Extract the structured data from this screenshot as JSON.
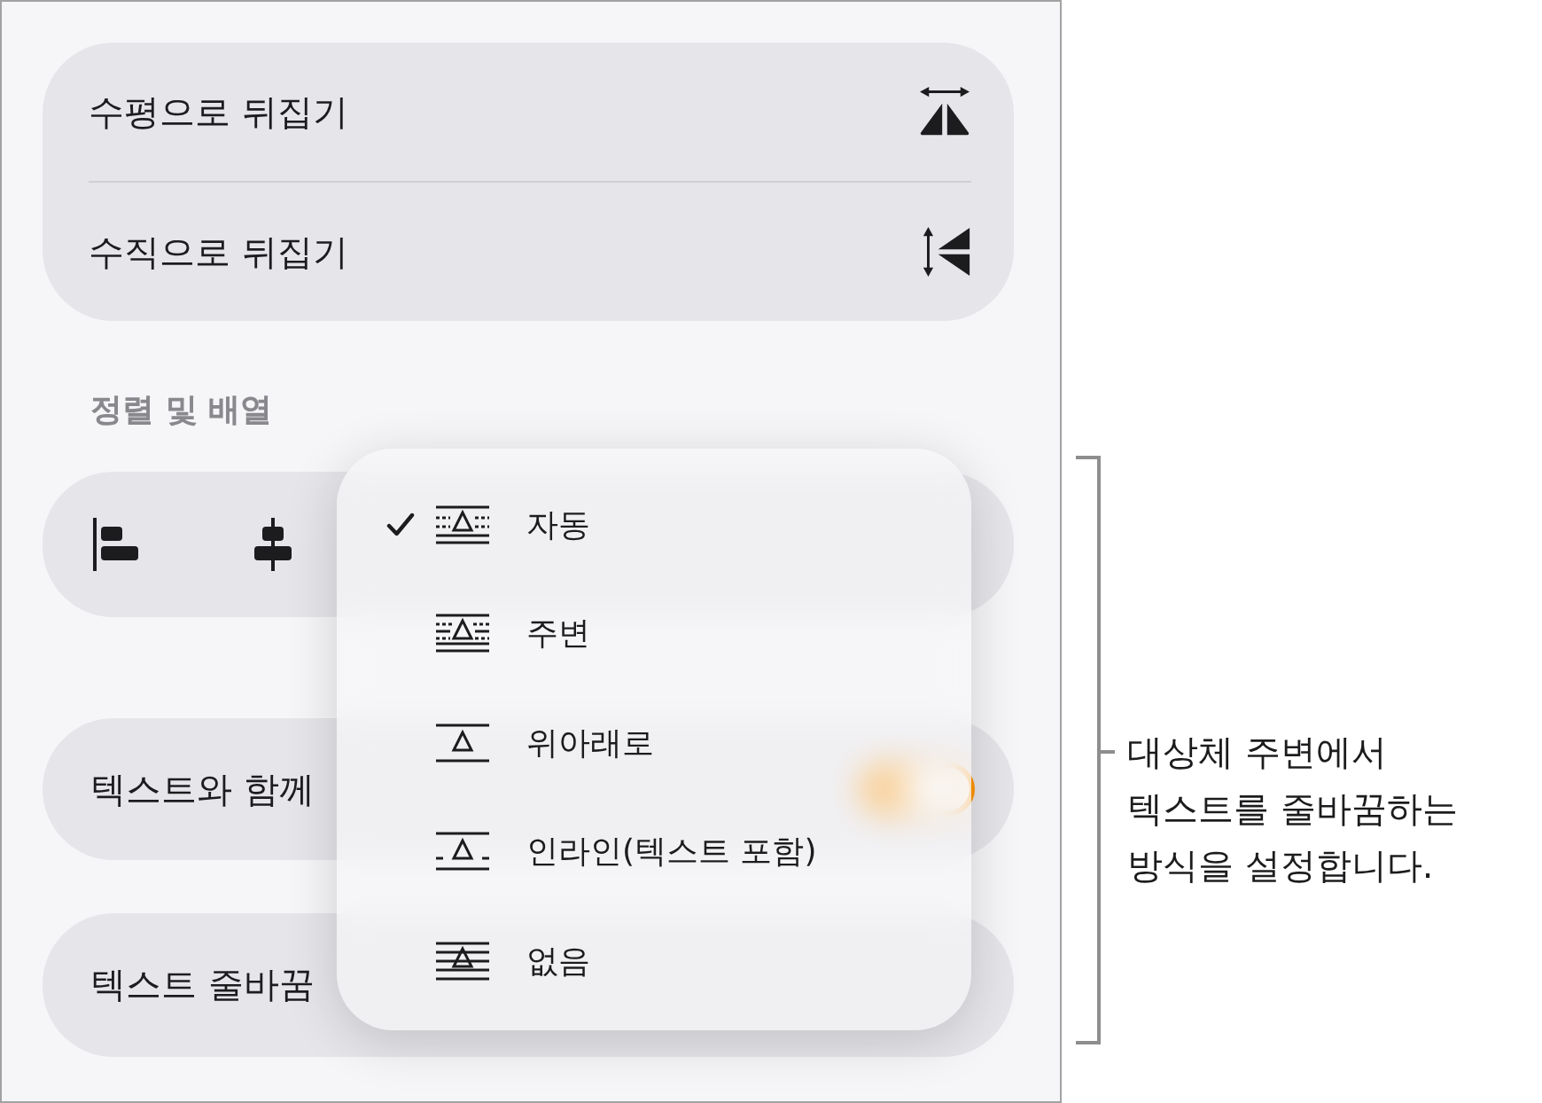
{
  "flip_options": [
    {
      "label": "수평으로 뒤집기",
      "kind": "horizontal"
    },
    {
      "label": "수직으로 뒤집기",
      "kind": "vertical"
    }
  ],
  "arrange": {
    "title": "정렬 및 배열",
    "align_buttons": [
      {
        "kind": "left"
      },
      {
        "kind": "center"
      }
    ]
  },
  "move_with_text": {
    "label": "텍스트와 함께",
    "on": true
  },
  "text_wrap": {
    "label": "텍스트 줄바꿈"
  },
  "wrap_menu": {
    "items": [
      {
        "label": "자동",
        "kind": "auto",
        "selected": true
      },
      {
        "label": "주변",
        "kind": "around",
        "selected": false
      },
      {
        "label": "위아래로",
        "kind": "top_bottom",
        "selected": false
      },
      {
        "label": "인라인(텍스트 포함)",
        "kind": "inline",
        "selected": false
      },
      {
        "label": "없음",
        "kind": "none",
        "selected": false
      }
    ]
  },
  "callout": {
    "lines": [
      "대상체 주변에서",
      "텍스트를 줄바꿈하는",
      "방식을 설정합니다."
    ]
  }
}
